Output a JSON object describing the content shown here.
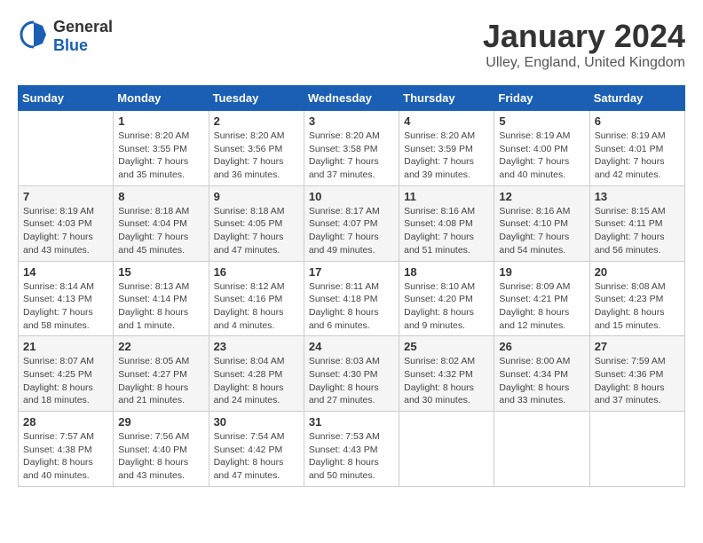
{
  "logo": {
    "general": "General",
    "blue": "Blue"
  },
  "title": "January 2024",
  "location": "Ulley, England, United Kingdom",
  "weekdays": [
    "Sunday",
    "Monday",
    "Tuesday",
    "Wednesday",
    "Thursday",
    "Friday",
    "Saturday"
  ],
  "weeks": [
    [
      {
        "day": "",
        "sunrise": "",
        "sunset": "",
        "daylight": ""
      },
      {
        "day": "1",
        "sunrise": "Sunrise: 8:20 AM",
        "sunset": "Sunset: 3:55 PM",
        "daylight": "Daylight: 7 hours and 35 minutes."
      },
      {
        "day": "2",
        "sunrise": "Sunrise: 8:20 AM",
        "sunset": "Sunset: 3:56 PM",
        "daylight": "Daylight: 7 hours and 36 minutes."
      },
      {
        "day": "3",
        "sunrise": "Sunrise: 8:20 AM",
        "sunset": "Sunset: 3:58 PM",
        "daylight": "Daylight: 7 hours and 37 minutes."
      },
      {
        "day": "4",
        "sunrise": "Sunrise: 8:20 AM",
        "sunset": "Sunset: 3:59 PM",
        "daylight": "Daylight: 7 hours and 39 minutes."
      },
      {
        "day": "5",
        "sunrise": "Sunrise: 8:19 AM",
        "sunset": "Sunset: 4:00 PM",
        "daylight": "Daylight: 7 hours and 40 minutes."
      },
      {
        "day": "6",
        "sunrise": "Sunrise: 8:19 AM",
        "sunset": "Sunset: 4:01 PM",
        "daylight": "Daylight: 7 hours and 42 minutes."
      }
    ],
    [
      {
        "day": "7",
        "sunrise": "Sunrise: 8:19 AM",
        "sunset": "Sunset: 4:03 PM",
        "daylight": "Daylight: 7 hours and 43 minutes."
      },
      {
        "day": "8",
        "sunrise": "Sunrise: 8:18 AM",
        "sunset": "Sunset: 4:04 PM",
        "daylight": "Daylight: 7 hours and 45 minutes."
      },
      {
        "day": "9",
        "sunrise": "Sunrise: 8:18 AM",
        "sunset": "Sunset: 4:05 PM",
        "daylight": "Daylight: 7 hours and 47 minutes."
      },
      {
        "day": "10",
        "sunrise": "Sunrise: 8:17 AM",
        "sunset": "Sunset: 4:07 PM",
        "daylight": "Daylight: 7 hours and 49 minutes."
      },
      {
        "day": "11",
        "sunrise": "Sunrise: 8:16 AM",
        "sunset": "Sunset: 4:08 PM",
        "daylight": "Daylight: 7 hours and 51 minutes."
      },
      {
        "day": "12",
        "sunrise": "Sunrise: 8:16 AM",
        "sunset": "Sunset: 4:10 PM",
        "daylight": "Daylight: 7 hours and 54 minutes."
      },
      {
        "day": "13",
        "sunrise": "Sunrise: 8:15 AM",
        "sunset": "Sunset: 4:11 PM",
        "daylight": "Daylight: 7 hours and 56 minutes."
      }
    ],
    [
      {
        "day": "14",
        "sunrise": "Sunrise: 8:14 AM",
        "sunset": "Sunset: 4:13 PM",
        "daylight": "Daylight: 7 hours and 58 minutes."
      },
      {
        "day": "15",
        "sunrise": "Sunrise: 8:13 AM",
        "sunset": "Sunset: 4:14 PM",
        "daylight": "Daylight: 8 hours and 1 minute."
      },
      {
        "day": "16",
        "sunrise": "Sunrise: 8:12 AM",
        "sunset": "Sunset: 4:16 PM",
        "daylight": "Daylight: 8 hours and 4 minutes."
      },
      {
        "day": "17",
        "sunrise": "Sunrise: 8:11 AM",
        "sunset": "Sunset: 4:18 PM",
        "daylight": "Daylight: 8 hours and 6 minutes."
      },
      {
        "day": "18",
        "sunrise": "Sunrise: 8:10 AM",
        "sunset": "Sunset: 4:20 PM",
        "daylight": "Daylight: 8 hours and 9 minutes."
      },
      {
        "day": "19",
        "sunrise": "Sunrise: 8:09 AM",
        "sunset": "Sunset: 4:21 PM",
        "daylight": "Daylight: 8 hours and 12 minutes."
      },
      {
        "day": "20",
        "sunrise": "Sunrise: 8:08 AM",
        "sunset": "Sunset: 4:23 PM",
        "daylight": "Daylight: 8 hours and 15 minutes."
      }
    ],
    [
      {
        "day": "21",
        "sunrise": "Sunrise: 8:07 AM",
        "sunset": "Sunset: 4:25 PM",
        "daylight": "Daylight: 8 hours and 18 minutes."
      },
      {
        "day": "22",
        "sunrise": "Sunrise: 8:05 AM",
        "sunset": "Sunset: 4:27 PM",
        "daylight": "Daylight: 8 hours and 21 minutes."
      },
      {
        "day": "23",
        "sunrise": "Sunrise: 8:04 AM",
        "sunset": "Sunset: 4:28 PM",
        "daylight": "Daylight: 8 hours and 24 minutes."
      },
      {
        "day": "24",
        "sunrise": "Sunrise: 8:03 AM",
        "sunset": "Sunset: 4:30 PM",
        "daylight": "Daylight: 8 hours and 27 minutes."
      },
      {
        "day": "25",
        "sunrise": "Sunrise: 8:02 AM",
        "sunset": "Sunset: 4:32 PM",
        "daylight": "Daylight: 8 hours and 30 minutes."
      },
      {
        "day": "26",
        "sunrise": "Sunrise: 8:00 AM",
        "sunset": "Sunset: 4:34 PM",
        "daylight": "Daylight: 8 hours and 33 minutes."
      },
      {
        "day": "27",
        "sunrise": "Sunrise: 7:59 AM",
        "sunset": "Sunset: 4:36 PM",
        "daylight": "Daylight: 8 hours and 37 minutes."
      }
    ],
    [
      {
        "day": "28",
        "sunrise": "Sunrise: 7:57 AM",
        "sunset": "Sunset: 4:38 PM",
        "daylight": "Daylight: 8 hours and 40 minutes."
      },
      {
        "day": "29",
        "sunrise": "Sunrise: 7:56 AM",
        "sunset": "Sunset: 4:40 PM",
        "daylight": "Daylight: 8 hours and 43 minutes."
      },
      {
        "day": "30",
        "sunrise": "Sunrise: 7:54 AM",
        "sunset": "Sunset: 4:42 PM",
        "daylight": "Daylight: 8 hours and 47 minutes."
      },
      {
        "day": "31",
        "sunrise": "Sunrise: 7:53 AM",
        "sunset": "Sunset: 4:43 PM",
        "daylight": "Daylight: 8 hours and 50 minutes."
      },
      {
        "day": "",
        "sunrise": "",
        "sunset": "",
        "daylight": ""
      },
      {
        "day": "",
        "sunrise": "",
        "sunset": "",
        "daylight": ""
      },
      {
        "day": "",
        "sunrise": "",
        "sunset": "",
        "daylight": ""
      }
    ]
  ]
}
